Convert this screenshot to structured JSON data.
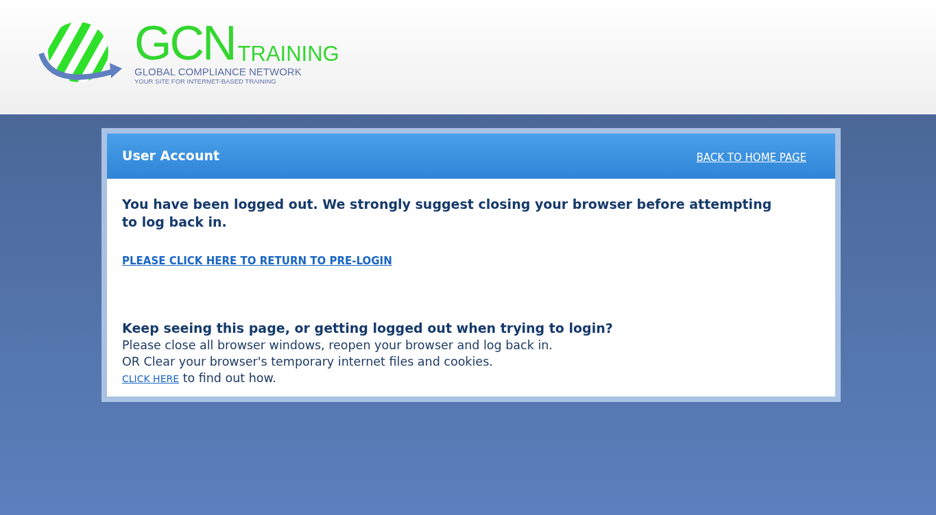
{
  "logo": {
    "mark": "GCN",
    "word": "TRAINING",
    "name": "GLOBAL COMPLIANCE NETWORK",
    "tagline": "YOUR SITE FOR INTERNET-BASED TRAINING"
  },
  "panel": {
    "title": "User Account",
    "home_link": "BACK TO HOME PAGE",
    "message": "You have been logged out. We strongly suggest closing your browser before attempting to log back in.",
    "return_link": "PLEASE CLICK HERE TO RETURN TO PRE-LOGIN",
    "help_heading": "Keep seeing this page, or getting logged out when trying to login?",
    "help_lines": [
      "Please close all browser windows, reopen your browser and log back in.",
      "OR Clear your browser's temporary internet files and cookies."
    ],
    "help_link": "CLICK HERE",
    "help_tail": "to find out how."
  }
}
